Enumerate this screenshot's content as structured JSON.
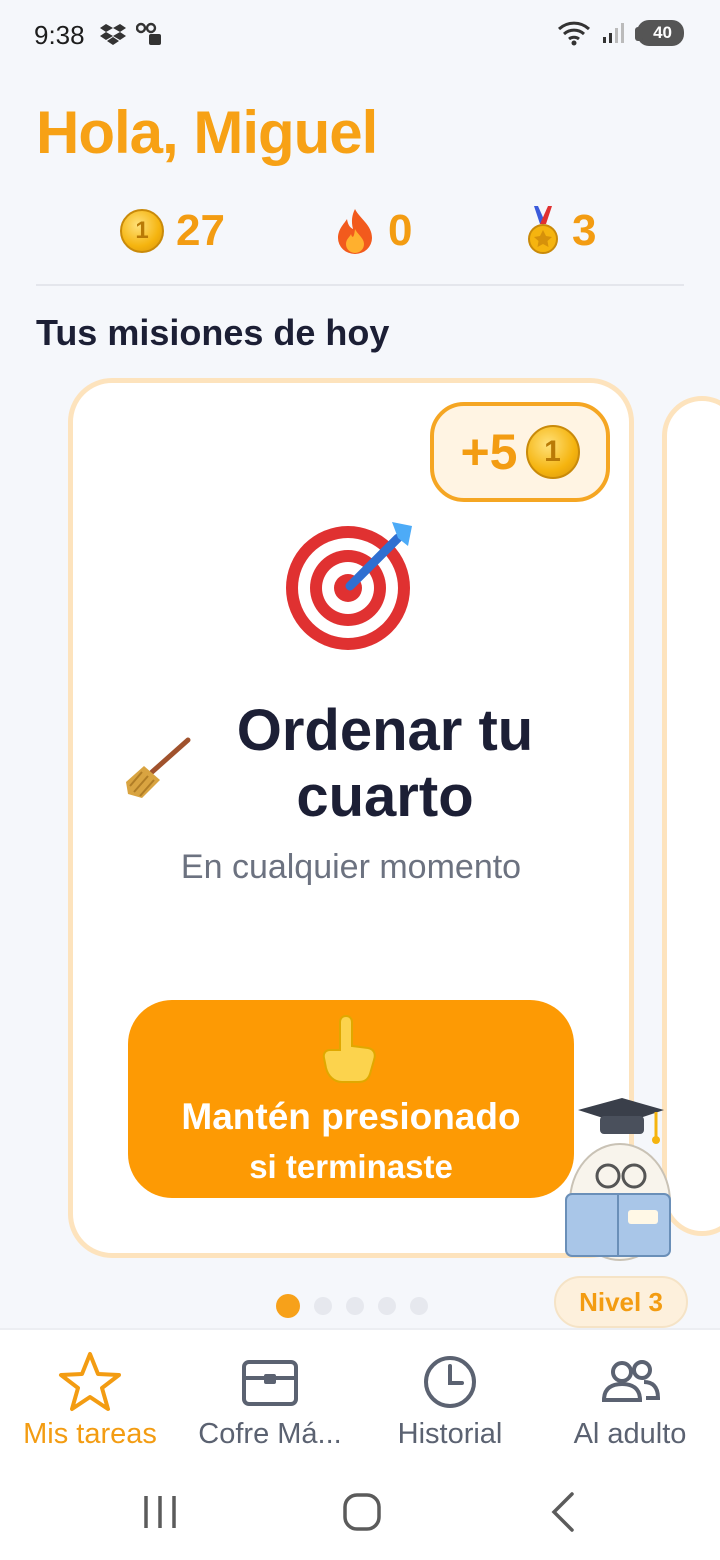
{
  "status_bar": {
    "time": "9:38",
    "battery": "40"
  },
  "greeting": "Hola, Miguel",
  "stats": {
    "coins": "27",
    "streak": "0",
    "medals": "3"
  },
  "section_title": "Tus misiones de hoy",
  "mission": {
    "reward": "+5",
    "title": "Ordenar tu cuarto",
    "subtitle": "En cualquier momento",
    "button_line1": "Mantén presionado",
    "button_line2": "si terminaste"
  },
  "level_badge": "Nivel 3",
  "carousel": {
    "total": 5,
    "active": 1
  },
  "bottom_nav": [
    {
      "label": "Mis tareas",
      "icon": "star-icon",
      "active": true
    },
    {
      "label": "Cofre Má...",
      "icon": "chest-icon",
      "active": false
    },
    {
      "label": "Historial",
      "icon": "clock-icon",
      "active": false
    },
    {
      "label": "Al adulto",
      "icon": "users-icon",
      "active": false
    }
  ],
  "colors": {
    "accent": "#f39c12",
    "button": "#fd9a04",
    "card_border": "#fde3bd",
    "title": "#1c1f35"
  }
}
